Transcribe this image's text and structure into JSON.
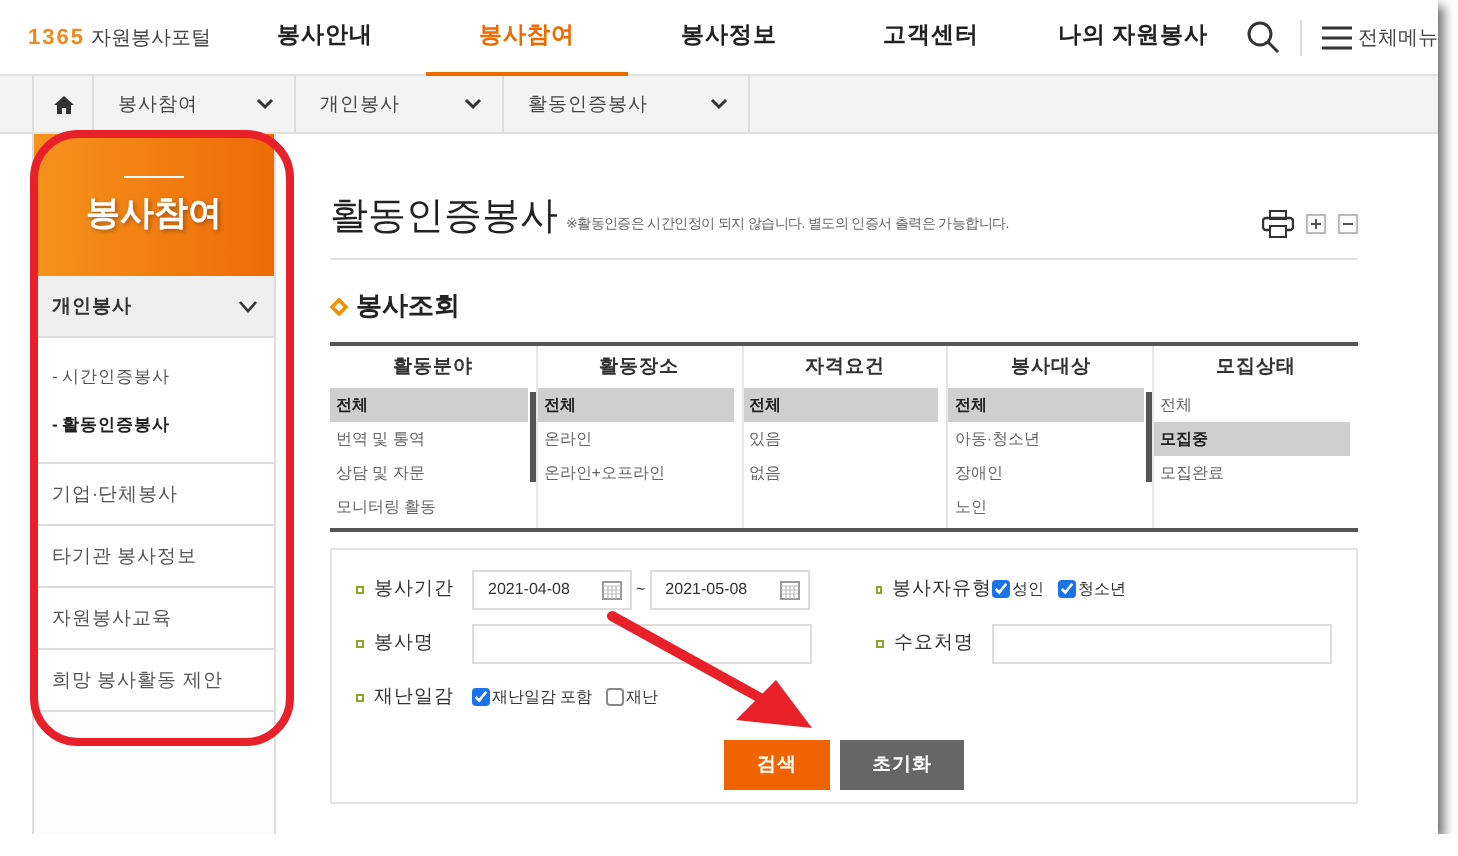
{
  "header": {
    "logo": {
      "number": "1365",
      "name": "자원봉사포털"
    },
    "menu": [
      {
        "label": "봉사안내",
        "selected": false
      },
      {
        "label": "봉사참여",
        "selected": true
      },
      {
        "label": "봉사정보",
        "selected": false
      },
      {
        "label": "고객센터",
        "selected": false
      },
      {
        "label": "나의 자원봉사",
        "selected": false
      }
    ],
    "all_menu": "전체메뉴"
  },
  "breadcrumb": [
    "봉사참여",
    "개인봉사",
    "활동인증봉사"
  ],
  "sidebar": {
    "title": "봉사참여",
    "items": [
      {
        "label": "개인봉사",
        "expanded": true,
        "children": [
          {
            "label": "- 시간인증봉사",
            "selected": false
          },
          {
            "label": "- 활동인증봉사",
            "selected": true
          }
        ]
      },
      {
        "label": "기업·단체봉사"
      },
      {
        "label": "타기관 봉사정보"
      },
      {
        "label": "자원봉사교육"
      },
      {
        "label": "희망 봉사활동 제안"
      }
    ]
  },
  "page": {
    "title": "활동인증봉사",
    "note": "※활동인증은 시간인정이 되지 않습니다. 별도의 인증서 출력은 가능합니다.",
    "section": "봉사조회"
  },
  "filters": [
    {
      "heading": "활동분야",
      "options": [
        {
          "label": "전체",
          "selected": true
        },
        {
          "label": "번역 및 통역",
          "selected": false
        },
        {
          "label": "상담 및 자문",
          "selected": false
        },
        {
          "label": "모니터링 활동",
          "selected": false
        }
      ]
    },
    {
      "heading": "활동장소",
      "options": [
        {
          "label": "전체",
          "selected": true
        },
        {
          "label": "온라인",
          "selected": false
        },
        {
          "label": "온라인+오프라인",
          "selected": false
        }
      ]
    },
    {
      "heading": "자격요건",
      "options": [
        {
          "label": "전체",
          "selected": true
        },
        {
          "label": "있음",
          "selected": false
        },
        {
          "label": "없음",
          "selected": false
        }
      ]
    },
    {
      "heading": "봉사대상",
      "options": [
        {
          "label": "전체",
          "selected": true
        },
        {
          "label": "아동·청소년",
          "selected": false
        },
        {
          "label": "장애인",
          "selected": false
        },
        {
          "label": "노인",
          "selected": false
        }
      ]
    },
    {
      "heading": "모집상태",
      "options": [
        {
          "label": "전체",
          "selected": false
        },
        {
          "label": "모집중",
          "selected": true
        },
        {
          "label": "모집완료",
          "selected": false
        }
      ]
    }
  ],
  "form": {
    "period": {
      "label": "봉사기간",
      "from": "2021-04-08",
      "to": "2021-05-08",
      "sep": "~"
    },
    "volunteer_type": {
      "label": "봉사자유형",
      "options": [
        {
          "label": "성인",
          "checked": true
        },
        {
          "label": "청소년",
          "checked": true
        }
      ]
    },
    "name": {
      "label": "봉사명"
    },
    "recipient": {
      "label": "수요처명"
    },
    "disaster": {
      "label": "재난일감",
      "options": [
        {
          "label": "재난일감 포함",
          "checked": true
        },
        {
          "label": "재난",
          "checked": false
        }
      ]
    },
    "buttons": [
      {
        "label": "검색",
        "kind": "primary"
      },
      {
        "label": "초기화",
        "kind": "secondary"
      }
    ]
  }
}
